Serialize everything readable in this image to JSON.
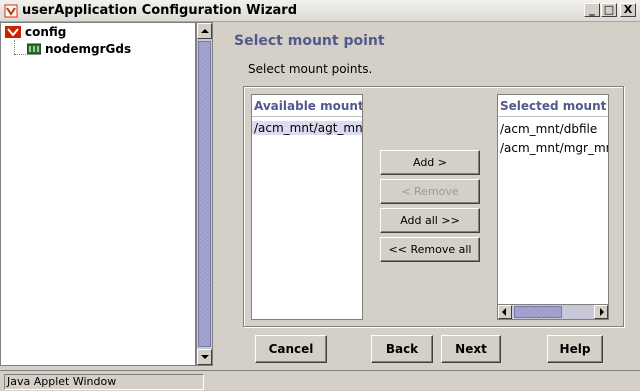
{
  "window": {
    "title": "userApplication Configuration Wizard",
    "icon": "app-icon",
    "controls": {
      "minimize": "_",
      "maximize": "□",
      "close": "X"
    }
  },
  "tree": {
    "root": {
      "label": "config",
      "icon": "config-icon"
    },
    "children": [
      {
        "label": "nodemgrGds",
        "icon": "node-icon"
      }
    ]
  },
  "content": {
    "heading": "Select mount point",
    "instruction": "Select mount points."
  },
  "available": {
    "header": "Available mount p...",
    "items": [
      "/acm_mnt/agt_mnt"
    ]
  },
  "selected": {
    "header": "Selected mount p...",
    "items": [
      "/acm_mnt/dbfile",
      "/acm_mnt/mgr_mnt"
    ]
  },
  "buttons": {
    "add": "Add >",
    "remove": "< Remove",
    "add_all": "Add all >>",
    "remove_all": "<< Remove all",
    "cancel": "Cancel",
    "back": "Back",
    "next": "Next",
    "help": "Help"
  },
  "status": {
    "text": "Java Applet Window"
  },
  "colors": {
    "accent": "#525a8c",
    "background": "#d4d0c8",
    "scroll_thumb": "#9c9cc8"
  }
}
